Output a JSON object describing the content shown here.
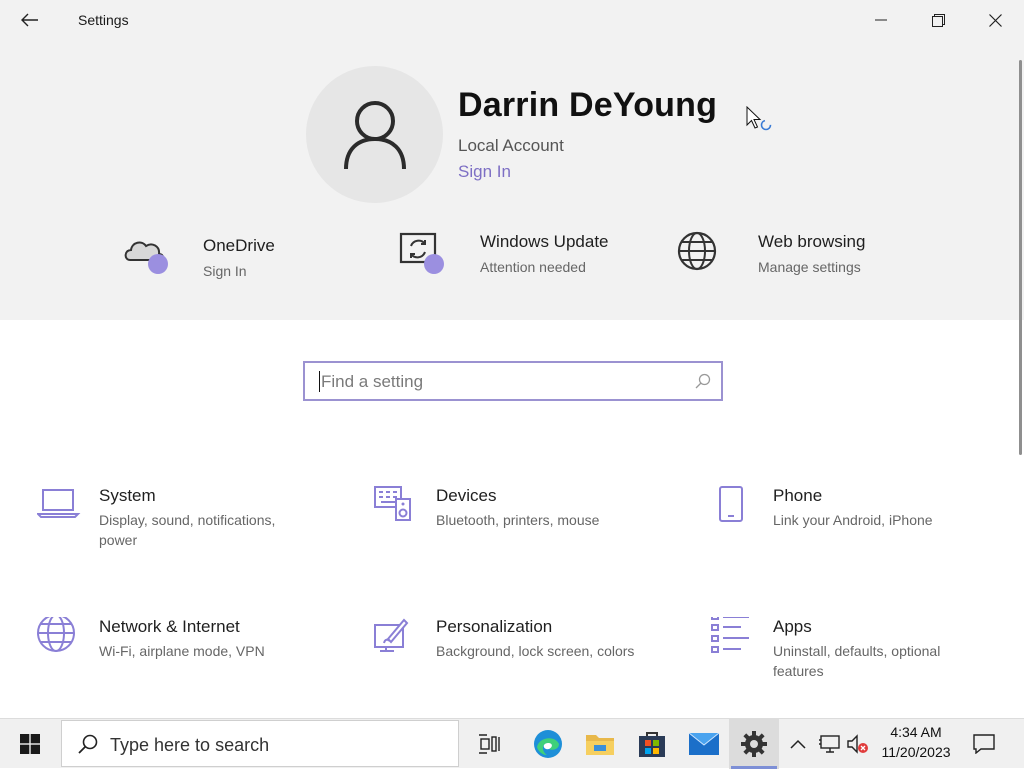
{
  "window": {
    "title": "Settings"
  },
  "profile": {
    "name": "Darrin DeYoung",
    "account_type": "Local Account",
    "sign_in_link": "Sign In"
  },
  "quick_links": [
    {
      "title": "OneDrive",
      "subtitle": "Sign In",
      "icon": "cloud-icon"
    },
    {
      "title": "Windows Update",
      "subtitle": "Attention needed",
      "icon": "update-icon"
    },
    {
      "title": "Web browsing",
      "subtitle": "Manage settings",
      "icon": "globe-icon"
    }
  ],
  "search": {
    "placeholder": "Find a setting"
  },
  "categories": [
    {
      "title": "System",
      "subtitle": "Display, sound, notifications, power",
      "icon": "laptop-icon"
    },
    {
      "title": "Devices",
      "subtitle": "Bluetooth, printers, mouse",
      "icon": "keyboard-speaker-icon"
    },
    {
      "title": "Phone",
      "subtitle": "Link your Android, iPhone",
      "icon": "phone-icon"
    },
    {
      "title": "Network & Internet",
      "subtitle": "Wi-Fi, airplane mode, VPN",
      "icon": "globe-icon"
    },
    {
      "title": "Personalization",
      "subtitle": "Background, lock screen, colors",
      "icon": "paint-icon"
    },
    {
      "title": "Apps",
      "subtitle": "Uninstall, defaults, optional features",
      "icon": "apps-list-icon"
    }
  ],
  "taskbar": {
    "search_placeholder": "Type here to search",
    "time": "4:34 AM",
    "date": "11/20/2023"
  },
  "colors": {
    "accent": "#9b8fe0",
    "link": "#7d6fc4",
    "header_bg": "#f2f2f2"
  }
}
